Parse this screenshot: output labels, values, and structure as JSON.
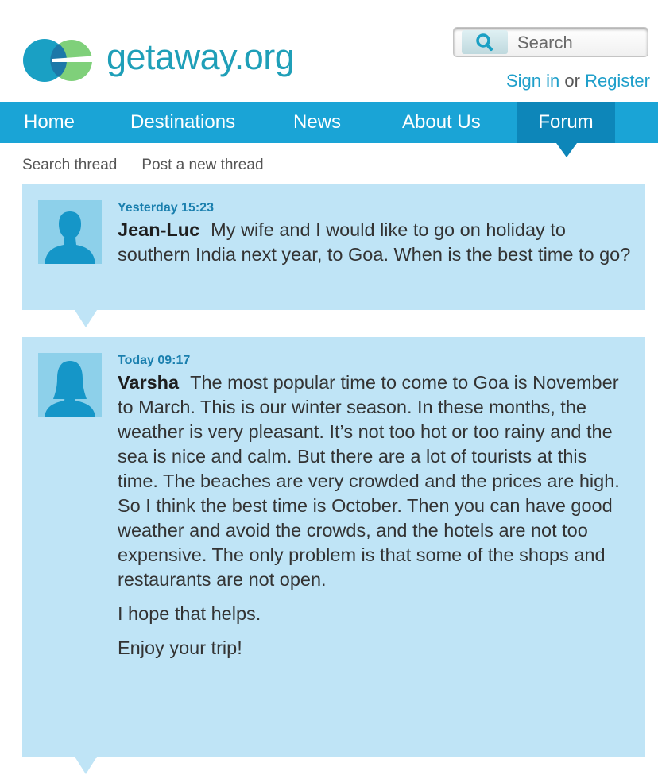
{
  "site": {
    "name": "getaway.org",
    "brand_color": "#1f9fb8"
  },
  "search": {
    "placeholder": "Search",
    "icon": "search-icon"
  },
  "auth": {
    "sign_in": "Sign in",
    "or": "or",
    "register": "Register"
  },
  "nav": {
    "items": [
      {
        "label": "Home"
      },
      {
        "label": "Destinations"
      },
      {
        "label": "News"
      },
      {
        "label": "About Us"
      },
      {
        "label": "Forum",
        "active": true
      }
    ],
    "color": "#1aa4d6",
    "active_color": "#0d86b9"
  },
  "toolbar": {
    "search_thread": "Search thread",
    "post_new_thread": "Post a new thread"
  },
  "posts": [
    {
      "timestamp": "Yesterday 15:23",
      "author": "Jean-Luc",
      "avatar": "male-avatar-icon",
      "message": "My wife and I would like to go on holiday to southern India next year, to Goa. When is the best time to go?"
    },
    {
      "timestamp": "Today 09:17",
      "author": "Varsha",
      "avatar": "female-avatar-icon",
      "message": "The most popular time to come to Goa is November to March. This is our winter season. In these months, the weather is very pleasant. It’s not too hot or too rainy and the sea is nice and calm. But there are a lot of tourists at this time. The beaches are very crowded and the prices are high. So I think the best time is October. Then you can have good weather and avoid the crowds, and the hotels are not too expensive. The only problem is that some of the shops and restaurants are not open.",
      "paragraphs": [
        "I hope that helps.",
        "Enjoy your trip!"
      ]
    }
  ]
}
